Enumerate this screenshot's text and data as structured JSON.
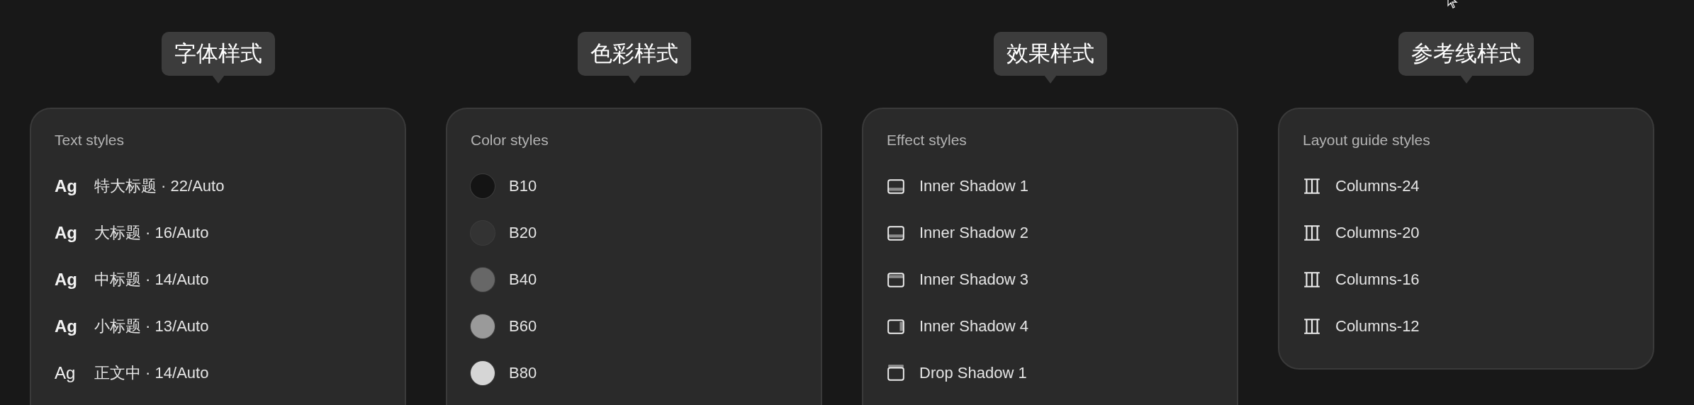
{
  "panels": [
    {
      "kind": "text",
      "tooltip": "字体样式",
      "title": "Text styles",
      "items": [
        {
          "sample": "Ag",
          "label": "特大标题 · 22/Auto",
          "kind": "bold"
        },
        {
          "sample": "Ag",
          "label": "大标题 · 16/Auto",
          "kind": "bold"
        },
        {
          "sample": "Ag",
          "label": "中标题 · 14/Auto",
          "kind": "bold"
        },
        {
          "sample": "Ag",
          "label": "小标题 · 13/Auto",
          "kind": "bold"
        },
        {
          "sample": "Ag",
          "label": "正文中 · 14/Auto",
          "kind": "regular"
        }
      ]
    },
    {
      "kind": "color",
      "tooltip": "色彩样式",
      "title": "Color styles",
      "items": [
        {
          "label": "B10",
          "color": "#141414"
        },
        {
          "label": "B20",
          "color": "#333333"
        },
        {
          "label": "B40",
          "color": "#676767"
        },
        {
          "label": "B60",
          "color": "#9a9a9a"
        },
        {
          "label": "B80",
          "color": "#d6d6d6"
        }
      ]
    },
    {
      "kind": "effect",
      "tooltip": "效果样式",
      "title": "Effect styles",
      "items": [
        {
          "label": "Inner Shadow 1",
          "kind": "inner-bottom"
        },
        {
          "label": "Inner Shadow 2",
          "kind": "inner-bottom"
        },
        {
          "label": "Inner Shadow 3",
          "kind": "inner-top"
        },
        {
          "label": "Inner Shadow 4",
          "kind": "inner-right"
        },
        {
          "label": "Drop Shadow 1",
          "kind": "drop"
        }
      ]
    },
    {
      "kind": "layout",
      "tooltip": "参考线样式",
      "title": "Layout guide styles",
      "items": [
        {
          "label": "Columns-24"
        },
        {
          "label": "Columns-20"
        },
        {
          "label": "Columns-16"
        },
        {
          "label": "Columns-12"
        }
      ]
    }
  ]
}
